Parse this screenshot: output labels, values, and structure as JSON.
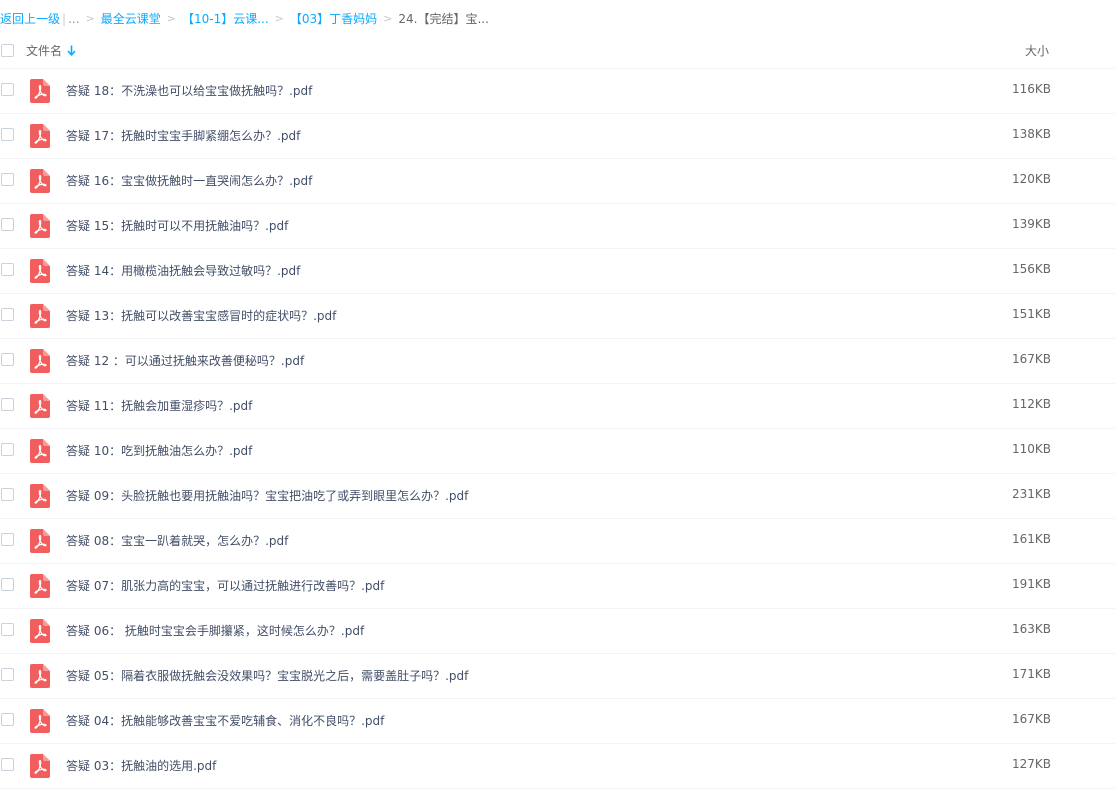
{
  "breadcrumb": {
    "back_label": "返回上一级",
    "ellipsis": "...",
    "items": [
      {
        "label": "最全云课堂"
      },
      {
        "label": "【10-1】云课..."
      },
      {
        "label": "【03】丁香妈妈"
      }
    ],
    "current": "24.【完结】宝..."
  },
  "table": {
    "columns": {
      "name": "文件名",
      "size": "大小"
    },
    "rows": [
      {
        "name": "答疑 18：不洗澡也可以给宝宝做抚触吗？.pdf",
        "size": "116KB"
      },
      {
        "name": "答疑 17：抚触时宝宝手脚紧绷怎么办？.pdf",
        "size": "138KB"
      },
      {
        "name": "答疑 16：宝宝做抚触时一直哭闹怎么办？.pdf",
        "size": "120KB"
      },
      {
        "name": "答疑 15：抚触时可以不用抚触油吗？.pdf",
        "size": "139KB"
      },
      {
        "name": "答疑 14：用橄榄油抚触会导致过敏吗？.pdf",
        "size": "156KB"
      },
      {
        "name": "答疑 13：抚触可以改善宝宝感冒时的症状吗？.pdf",
        "size": "151KB"
      },
      {
        "name": "答疑 12 ：可以通过抚触来改善便秘吗？.pdf",
        "size": "167KB"
      },
      {
        "name": "答疑 11：抚触会加重湿疹吗？.pdf",
        "size": "112KB"
      },
      {
        "name": "答疑 10：吃到抚触油怎么办？.pdf",
        "size": "110KB"
      },
      {
        "name": "答疑 09：头脸抚触也要用抚触油吗？宝宝把油吃了或弄到眼里怎么办？.pdf",
        "size": "231KB"
      },
      {
        "name": "答疑 08：宝宝一趴着就哭，怎么办？.pdf",
        "size": "161KB"
      },
      {
        "name": "答疑 07：肌张力高的宝宝，可以通过抚触进行改善吗？.pdf",
        "size": "191KB"
      },
      {
        "name": "答疑 06： 抚触时宝宝会手脚攥紧，这时候怎么办？.pdf",
        "size": "163KB"
      },
      {
        "name": "答疑 05：隔着衣服做抚触会没效果吗？宝宝脱光之后，需要盖肚子吗？.pdf",
        "size": "171KB"
      },
      {
        "name": "答疑 04：抚触能够改善宝宝不爱吃辅食、消化不良吗？.pdf",
        "size": "167KB"
      },
      {
        "name": "答疑 03：抚触油的选用.pdf",
        "size": "127KB"
      }
    ]
  },
  "icons": {
    "file": "pdf-file-icon",
    "sort": "sort-down-arrow-icon"
  },
  "colors": {
    "link": "#09aaff",
    "pdf_red": "#f25d5d",
    "text": "#424e67",
    "border": "#f1f3f5"
  }
}
